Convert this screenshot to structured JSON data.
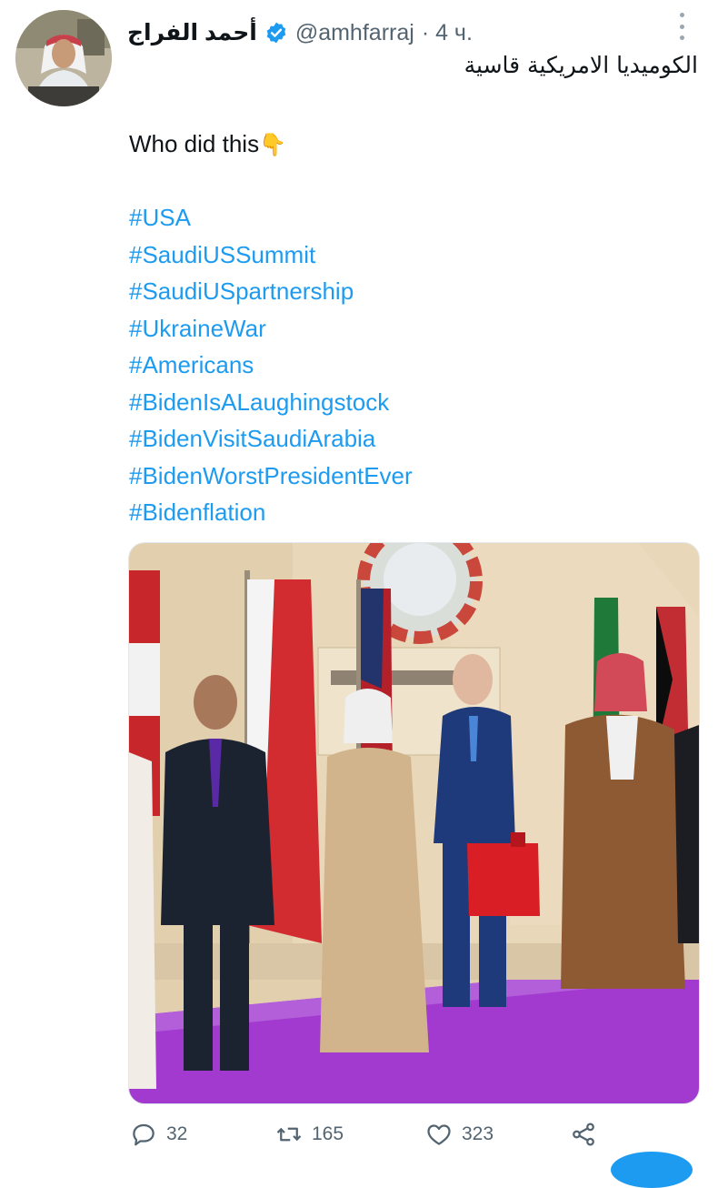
{
  "tweet": {
    "author_name": "أحمد الفراج",
    "handle": "@amhfarraj",
    "time": "· 4 ч.",
    "arabic_text": "الكوميديا الامريكية قاسية",
    "line1": "Who did this",
    "emoji": "👇",
    "hashtags": [
      "#USA",
      "#SaudiUSSummit",
      "#SaudiUSpartnership",
      "#UkraineWar",
      "#Americans",
      "#BidenIsALaughingstock",
      "#BidenVisitSaudiArabia",
      "#BidenWorstPresidentEver",
      "#Bidenflation"
    ]
  },
  "actions": {
    "replies": "32",
    "retweets": "165",
    "likes": "323"
  },
  "icons": {
    "verified": "verified-badge-icon",
    "more": "more-options-icon",
    "reply": "reply-icon",
    "retweet": "retweet-icon",
    "like": "heart-icon",
    "share": "share-icon"
  },
  "colors": {
    "link": "#1d9bf0",
    "secondary_text": "#536471",
    "carpet": "#a23ad0"
  }
}
